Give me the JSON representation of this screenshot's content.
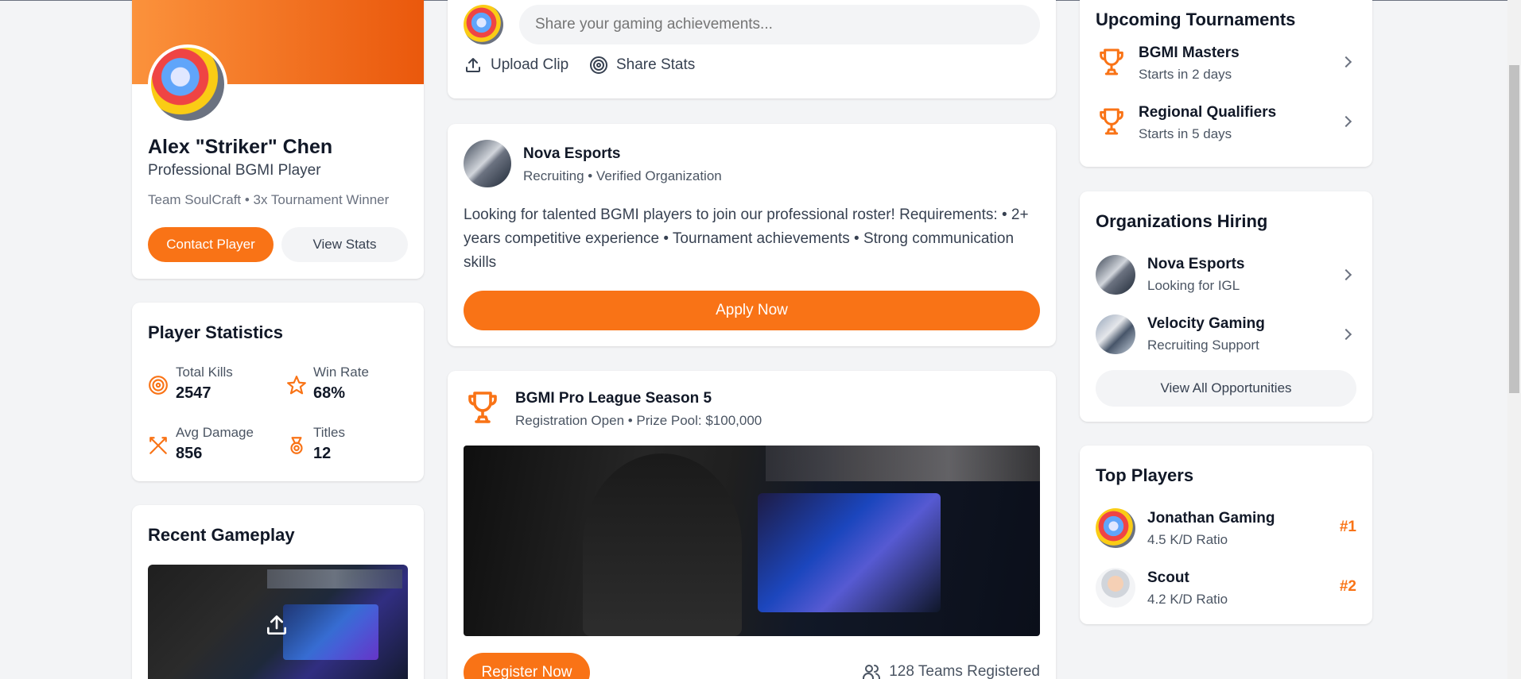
{
  "colors": {
    "accent": "#f97316",
    "background": "#f3f4f6"
  },
  "profile": {
    "name": "Alex \"Striker\" Chen",
    "title": "Professional BGMI Player",
    "meta": "Team SoulCraft • 3x Tournament Winner",
    "contact_label": "Contact Player",
    "view_stats_label": "View Stats"
  },
  "stats": {
    "heading": "Player Statistics",
    "items": [
      {
        "icon": "target-icon",
        "label": "Total Kills",
        "value": "2547"
      },
      {
        "icon": "star-icon",
        "label": "Win Rate",
        "value": "68%"
      },
      {
        "icon": "swords-icon",
        "label": "Avg Damage",
        "value": "856"
      },
      {
        "icon": "medal-icon",
        "label": "Titles",
        "value": "12"
      }
    ]
  },
  "gameplay": {
    "heading": "Recent Gameplay"
  },
  "composer": {
    "placeholder": "Share your gaming achievements...",
    "upload_label": "Upload Clip",
    "share_label": "Share Stats"
  },
  "post1": {
    "org": "Nova Esports",
    "meta": "Recruiting • Verified Organization",
    "body": "Looking for talented BGMI players to join our professional roster! Requirements: • 2+ years competitive experience • Tournament achievements • Strong communication skills",
    "apply_label": "Apply Now"
  },
  "post2": {
    "title": "BGMI Pro League Season 5",
    "meta": "Registration Open • Prize Pool: $100,000",
    "register_label": "Register Now",
    "teams": "128 Teams Registered"
  },
  "tournaments": {
    "heading": "Upcoming Tournaments",
    "items": [
      {
        "name": "BGMI Masters",
        "when": "Starts in 2 days"
      },
      {
        "name": "Regional Qualifiers",
        "when": "Starts in 5 days"
      }
    ]
  },
  "hiring": {
    "heading": "Organizations Hiring",
    "items": [
      {
        "name": "Nova Esports",
        "role": "Looking for IGL"
      },
      {
        "name": "Velocity Gaming",
        "role": "Recruiting Support"
      }
    ],
    "view_all_label": "View All Opportunities"
  },
  "top_players": {
    "heading": "Top Players",
    "items": [
      {
        "name": "Jonathan Gaming",
        "kd": "4.5 K/D Ratio",
        "rank": "#1"
      },
      {
        "name": "Scout",
        "kd": "4.2 K/D Ratio",
        "rank": "#2"
      }
    ]
  }
}
